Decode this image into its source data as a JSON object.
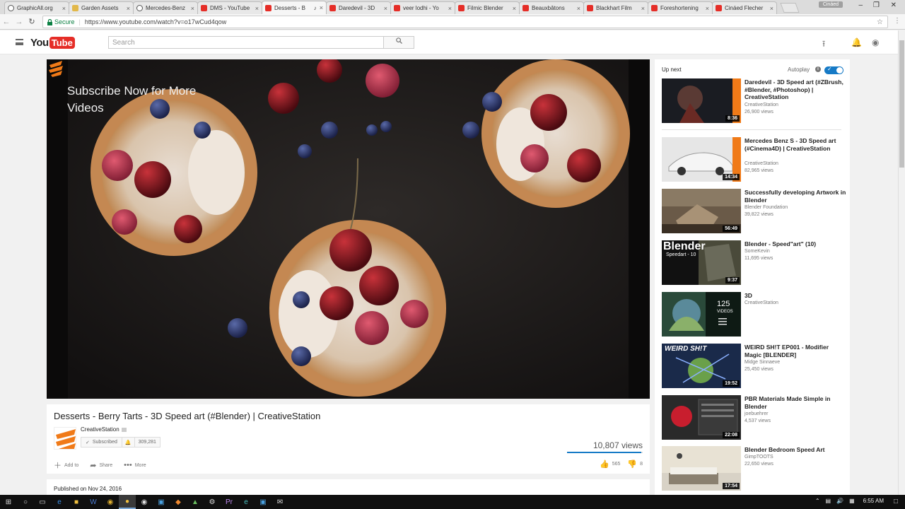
{
  "browser": {
    "tabs": [
      {
        "label": "GraphicAll.org",
        "fav": "round"
      },
      {
        "label": "Garden Assets",
        "fav": "sq"
      },
      {
        "label": "Mercedes-Benz",
        "fav": "round"
      },
      {
        "label": "DMS - YouTube",
        "fav": "yt"
      },
      {
        "label": "Desserts - B",
        "fav": "yt",
        "active": true
      },
      {
        "label": "Daredevil - 3D",
        "fav": "yt"
      },
      {
        "label": "veer lodhi - Yo",
        "fav": "yt"
      },
      {
        "label": "Filmic Blender",
        "fav": "yt"
      },
      {
        "label": "Beauxbâtons",
        "fav": "yt"
      },
      {
        "label": "Blackhart Film",
        "fav": "yt"
      },
      {
        "label": "Foreshortening",
        "fav": "yt"
      },
      {
        "label": "Cináed Flecher",
        "fav": "yt"
      }
    ],
    "profile_name": "Cináed",
    "secure_label": "Secure",
    "url": "https://www.youtube.com/watch?v=o17wCud4qow"
  },
  "yt": {
    "logo_you": "You",
    "logo_tube": "Tube",
    "search_placeholder": "Search"
  },
  "video": {
    "annotation": "Subscribe Now for More Videos",
    "title": "Desserts - Berry Tarts - 3D Speed art (#Blender) | CreativeStation",
    "channel": "CreativeStation",
    "subscribed_label": "Subscribed",
    "subscriber_count": "309,281",
    "views": "10,807 views",
    "views_fraction": 0.98,
    "actions": {
      "add_to": "Add to",
      "share": "Share",
      "more": "More"
    },
    "likes": "565",
    "dislikes": "8",
    "published": "Published on Nov 24, 2016"
  },
  "sidebar": {
    "up_next": "Up next",
    "autoplay": "Autoplay",
    "items": [
      {
        "title": "Daredevil - 3D Speed art (#ZBrush, #Blender, #Photoshop) | CreativeStation",
        "channel": "CreativeStation",
        "views": "26,900 views",
        "duration": "8:36"
      },
      {
        "title": "Mercedes Benz S - 3D Speed art (#Cinema4D) | CreativeStation",
        "channel": "CreativeStation",
        "views": "82,965 views",
        "duration": "14:34"
      },
      {
        "title": "Successfully developing Artwork in Blender",
        "channel": "Blender Foundation",
        "views": "39,822 views",
        "duration": "56:49"
      },
      {
        "title": "Blender - Speed\"art\" (10)",
        "channel": "SomeKevin",
        "views": "11,695 views",
        "duration": "9:37"
      },
      {
        "title": "3D",
        "channel": "CreativeStation",
        "views": "",
        "duration": ""
      },
      {
        "title": "WEIRD SH!T EP001 - Modifier Magic [BLENDER]",
        "channel": "Midge Sinnaeve",
        "views": "25,450 views",
        "duration": "19:52"
      },
      {
        "title": "PBR Materials Made Simple in Blender",
        "channel": "joebuehrer",
        "views": "4,537 views",
        "duration": "22:08"
      },
      {
        "title": "Blender Bedroom Speed Art",
        "channel": "GimpTOOTS",
        "views": "22,650 views",
        "duration": "17:54"
      }
    ],
    "thumb_texts": {
      "blender": "Blender",
      "speedart": "Speedart - 10",
      "playlist_count": "125",
      "playlist_videos": "VIDEOS",
      "weird": "WEIRD SH!T"
    }
  },
  "taskbar": {
    "time": "6:55 AM"
  }
}
